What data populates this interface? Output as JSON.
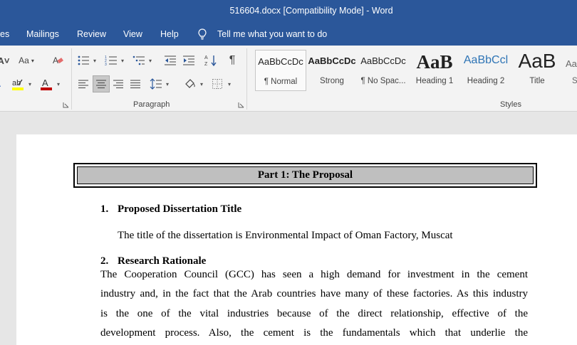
{
  "window": {
    "title": "516604.docx [Compatibility Mode]  -  Word"
  },
  "tabs": [
    {
      "label": "es"
    },
    {
      "label": "Mailings"
    },
    {
      "label": "Review"
    },
    {
      "label": "View"
    },
    {
      "label": "Help"
    }
  ],
  "tell_me": {
    "placeholder": "Tell me what you want to do"
  },
  "ribbon": {
    "font_group": {
      "change_case_label": "Aa",
      "highlight_color": "#ffff00",
      "font_color": "#c00000"
    },
    "paragraph_group": {
      "label": "Paragraph"
    },
    "styles_group": {
      "label": "Styles",
      "items": [
        {
          "sample": "AaBbCcDc",
          "name": "¶ Normal",
          "selected": true
        },
        {
          "sample": "AaBbCcDc",
          "name": "Strong"
        },
        {
          "sample": "AaBbCcDc",
          "name": "¶ No Spac..."
        },
        {
          "sample": "AaB",
          "name": "Heading 1"
        },
        {
          "sample": "AaBbCcl",
          "name": "Heading 2"
        },
        {
          "sample": "AaB",
          "name": "Title"
        },
        {
          "sample": "Aa",
          "name": "S"
        }
      ]
    }
  },
  "document": {
    "heading": "Part 1: The Proposal",
    "section1": {
      "number": "1.",
      "title": "Proposed Dissertation Title"
    },
    "title_sentence": "The title of the dissertation is Environmental Impact of Oman Factory, Muscat",
    "section2": {
      "number": "2.",
      "title": "Research Rationale"
    },
    "rationale_lines": [
      "The Cooperation Council (GCC) has seen a high demand for investment in the cement",
      "industry and, in the fact that the Arab countries have many of these factories. As this industry",
      "is the one of the vital industries because of the direct relationship, effective of the",
      "development process. Also, the cement is the fundamentals which that underlie the"
    ]
  },
  "colors": {
    "title_bar": "#2b579a",
    "ribbon": "#f3f3f3",
    "canvas": "#e6e6e6"
  }
}
